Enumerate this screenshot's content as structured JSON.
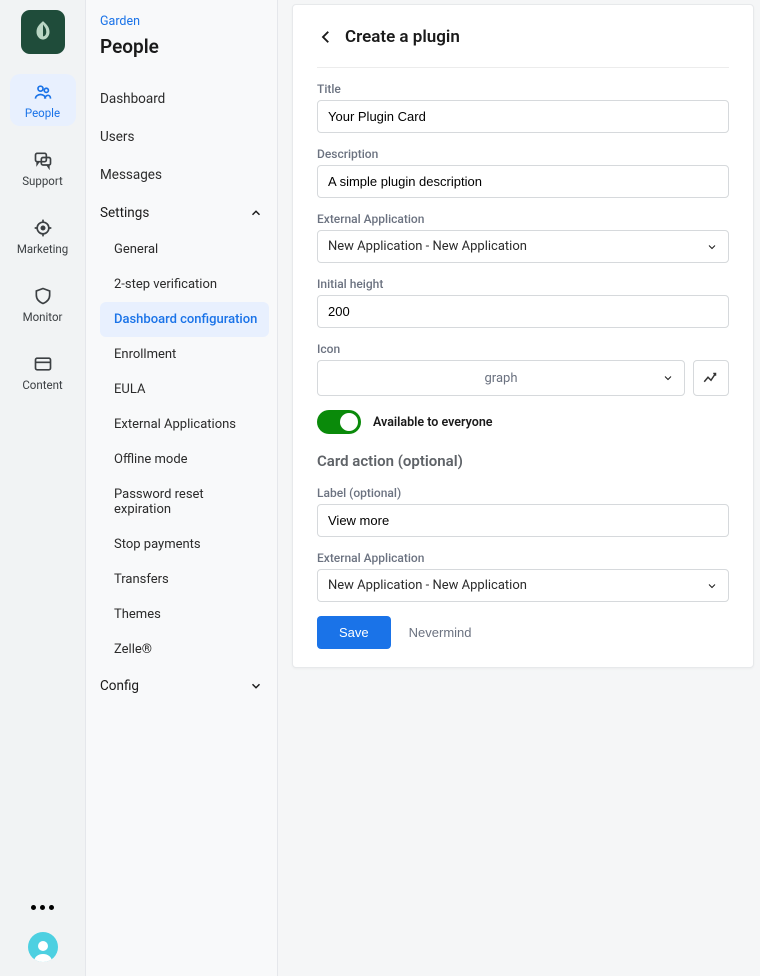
{
  "rail": {
    "items": [
      {
        "label": "People"
      },
      {
        "label": "Support"
      },
      {
        "label": "Marketing"
      },
      {
        "label": "Monitor"
      },
      {
        "label": "Content"
      }
    ]
  },
  "sidebar": {
    "breadcrumb": "Garden",
    "title": "People",
    "links": [
      "Dashboard",
      "Users",
      "Messages"
    ],
    "settings": {
      "label": "Settings",
      "children": [
        "General",
        "2-step verification",
        "Dashboard configuration",
        "Enrollment",
        "EULA",
        "External Applications",
        "Offline mode",
        "Password reset expiration",
        "Stop payments",
        "Transfers",
        "Themes",
        "Zelle®"
      ]
    },
    "config": {
      "label": "Config"
    }
  },
  "form": {
    "header": "Create a plugin",
    "title_label": "Title",
    "title_value": "Your Plugin Card",
    "desc_label": "Description",
    "desc_value": "A simple plugin description",
    "extapp_label": "External Application",
    "extapp_value": "New Application - New Application",
    "height_label": "Initial height",
    "height_value": "200",
    "icon_label": "Icon",
    "icon_value": "graph",
    "toggle_label": "Available to everyone",
    "card_action_header": "Card action (optional)",
    "action_label_label": "Label (optional)",
    "action_label_value": "View more",
    "action_extapp_label": "External Application",
    "action_extapp_value": "New Application - New Application",
    "save": "Save",
    "cancel": "Nevermind"
  }
}
